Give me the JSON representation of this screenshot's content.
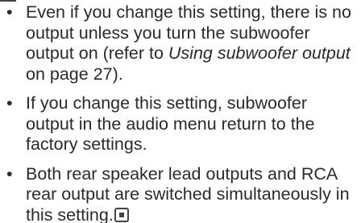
{
  "notes": [
    {
      "pre": "Even if you change this setting, there is no output unless you turn the subwoofer output on (refer to ",
      "ital": "Using subwoofer output",
      "post": " on page 27)."
    },
    {
      "text": "If you change this setting, subwoofer output in the audio menu return to the factory settings."
    },
    {
      "text": "Both rear speaker lead outputs and RCA rear output are switched simultaneously in this setting."
    }
  ],
  "bullet_glyph": "•",
  "end_icon": "end-of-section-icon"
}
